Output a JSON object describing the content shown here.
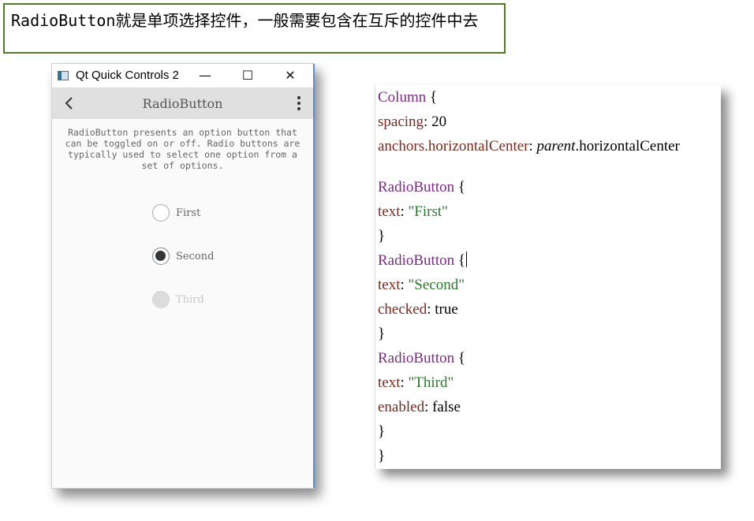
{
  "annotation": {
    "text": "RadioButton就是单项选择控件，一般需要包含在互斥的控件中去"
  },
  "window": {
    "title": "Qt Quick Controls 2",
    "minimize_glyph": "—",
    "maximize_glyph": "☐",
    "close_glyph": "✕",
    "toolbar_title": "RadioButton",
    "description": "RadioButton presents an option button that can be toggled on or off. Radio buttons are typically used to select one option from a set of options.",
    "radios": [
      {
        "label": "First",
        "checked": false,
        "enabled": true
      },
      {
        "label": "Second",
        "checked": true,
        "enabled": true
      },
      {
        "label": "Third",
        "checked": false,
        "enabled": false
      }
    ]
  },
  "code": {
    "lines": [
      {
        "k": "Column",
        "rest": " {"
      },
      {
        "p": "spacing",
        "rest": ": 20"
      },
      {
        "p": "anchors.horizontalCenter",
        "rest": ": ",
        "it": "parent",
        "tail": ".horizontalCenter"
      },
      {
        "k": "RadioButton",
        "rest": " {"
      },
      {
        "p": "text",
        "rest": ": ",
        "s": "\"First\""
      },
      {
        "rest": "}"
      },
      {
        "k": "RadioButton",
        "rest": " {"
      },
      {
        "p": "text",
        "rest": ": ",
        "s": "\"Second\""
      },
      {
        "p": "checked",
        "rest": ": true"
      },
      {
        "rest": "}"
      },
      {
        "k": "RadioButton",
        "rest": " {"
      },
      {
        "p": "text",
        "rest": ": ",
        "s": "\"Third\""
      },
      {
        "p": "enabled",
        "rest": ": false"
      },
      {
        "rest": "}"
      },
      {
        "rest": "}"
      }
    ]
  }
}
